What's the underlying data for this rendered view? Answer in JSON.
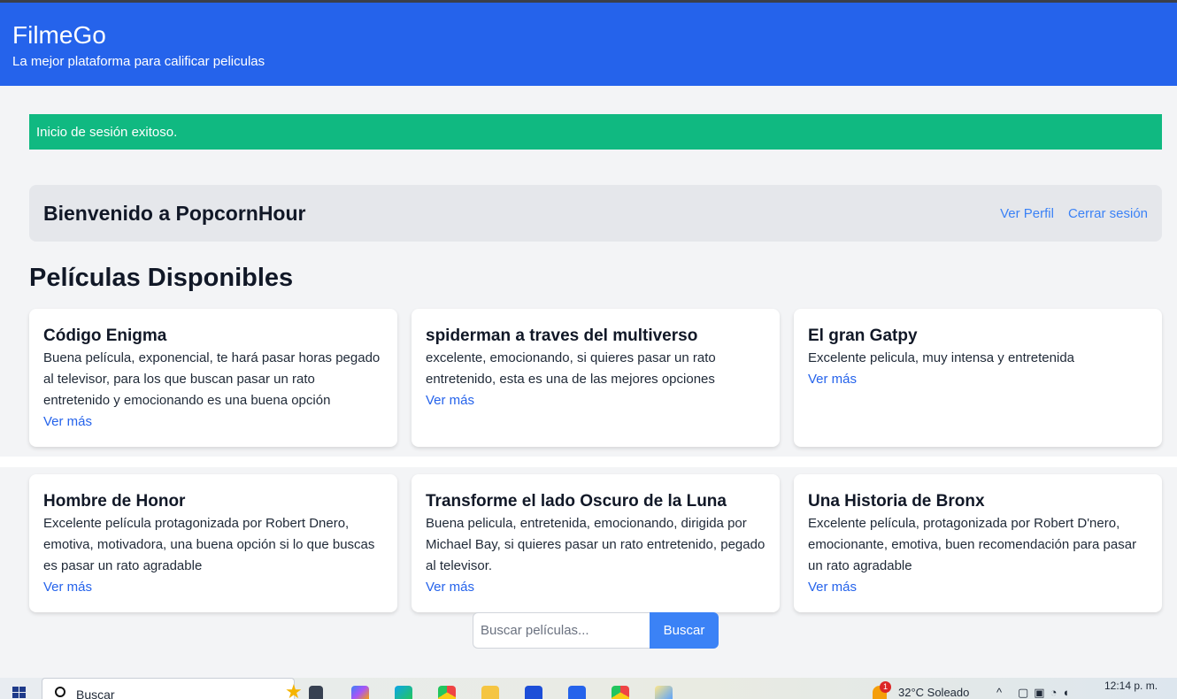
{
  "header": {
    "brand": "FilmeGo",
    "tagline": "La mejor plataforma para calificar peliculas"
  },
  "alert": {
    "message": "Inicio de sesión exitoso."
  },
  "welcome": {
    "title": "Bienvenido a PopcornHour",
    "profile_link": "Ver Perfil",
    "logout_link": "Cerrar sesión"
  },
  "movies_section": {
    "title": "Películas Disponibles"
  },
  "movies": [
    {
      "title": "Código Enigma",
      "description": "Buena película, exponencial, te hará pasar horas pegado al televisor, para los que buscan pasar un rato entretenido y emocionando es una buena opción",
      "link": "Ver más"
    },
    {
      "title": "spiderman a traves del multiverso",
      "description": "excelente, emocionando, si quieres pasar un rato entretenido, esta es una de las mejores opciones",
      "link": "Ver más"
    },
    {
      "title": "El gran Gatpy",
      "description": "Excelente pelicula, muy intensa y entretenida",
      "link": "Ver más"
    },
    {
      "title": "Hombre de Honor",
      "description": "Excelente película protagonizada por Robert Dnero, emotiva, motivadora, una buena opción si lo que buscas es pasar un rato agradable",
      "link": "Ver más"
    },
    {
      "title": "Transforme el lado Oscuro de la Luna",
      "description": "Buena pelicula, entretenida, emocionando, dirigida por Michael Bay, si quieres pasar un rato entretenido, pegado al televisor.",
      "link": "Ver más"
    },
    {
      "title": "Una Historia de Bronx",
      "description": "Excelente película, protagonizada por Robert D'nero, emocionante, emotiva, buen recomendación para pasar un rato agradable",
      "link": "Ver más"
    }
  ],
  "search": {
    "placeholder": "Buscar películas...",
    "button_label": "Buscar"
  },
  "taskbar": {
    "search_label": "Buscar",
    "weather": "32°C  Soleado",
    "notification_count": "1",
    "clock": "12:14 p. m.",
    "icons": [
      "windows-start-icon",
      "task-view-icon",
      "copilot-icon",
      "edge-icon",
      "chrome-icon",
      "file-explorer-icon",
      "store-icon",
      "vscode-icon",
      "chrome-icon",
      "paint-icon"
    ]
  },
  "colors": {
    "header": "#2563eb",
    "alert": "#10b981",
    "link": "#2563eb",
    "button": "#3b82f6"
  }
}
